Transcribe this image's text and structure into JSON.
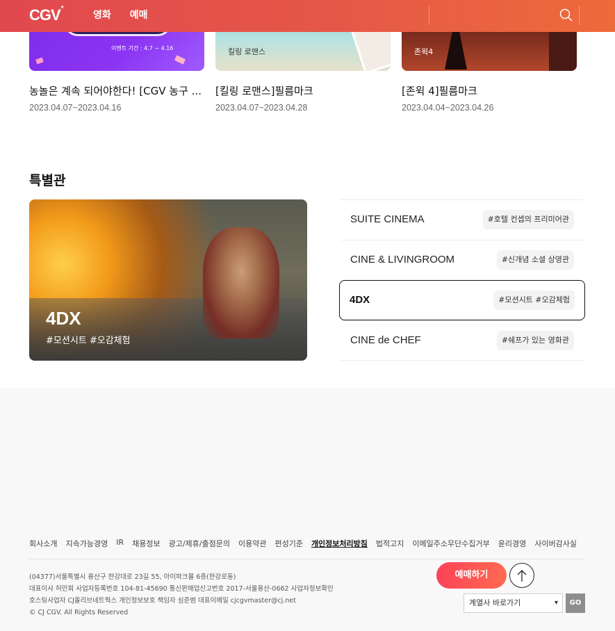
{
  "header": {
    "logo": "CGV",
    "logo_mark": "*",
    "nav": [
      "영화",
      "예매"
    ],
    "search_icon": "search-icon"
  },
  "events": [
    {
      "title": "농놀은 계속 되어야한다! [CGV 농구 ...",
      "date": "2023.04.07~2023.04.16",
      "thumb_text": "이벤트 기간 : 4.7 ~ 4.16"
    },
    {
      "title": "[킬링 로맨스]필름마크",
      "date": "2023.04.07~2023.04.28",
      "thumb_text": "킬링 로맨스"
    },
    {
      "title": "[존윅 4]필름마크",
      "date": "2023.04.04~2023.04.26",
      "thumb_text": "존윅4"
    }
  ],
  "special": {
    "title": "특별관",
    "visual": {
      "name": "4DX",
      "tags": "#모션시트 #오감체험"
    },
    "items": [
      {
        "name": "SUITE CINEMA",
        "tag": "#호텔 컨셉의 프리미어관"
      },
      {
        "name": "CINE & LIVINGROOM",
        "tag": "#신개념 소셜 상영관"
      },
      {
        "name": "4DX",
        "tag": "#모션시트 #오감체험"
      },
      {
        "name": "CINE de CHEF",
        "tag": "#쉐프가 있는 영화관"
      }
    ]
  },
  "footer": {
    "links": [
      "회사소개",
      "지속가능경영",
      "IR",
      "채용정보",
      "광고/제휴/출점문의",
      "이용약관",
      "편성기준",
      "개인정보처리방침",
      "법적고지",
      "이메일주소무단수집거부",
      "윤리경영",
      "사이버감사실"
    ],
    "info": [
      "(04377)서울특별시 용산구 한강대로 23길 55, 아이파크몰 6층(한강로동)",
      "대표이사 허민회 사업자등록번호 104-81-45690 통신판매업신고번호 2017-서울용산-0662 사업자정보확인",
      "호스팅사업자 CJ올리브네트웍스 개인정보보호 책임자 심준범 대표이메일 cjcgvmaster@cj.net",
      "© CJ CGV. All Rights Reserved"
    ],
    "reserve_label": "예매하기",
    "affiliate_select": "계열사 바로가기",
    "go_label": "GO"
  },
  "colors": {
    "brand": "#e1484f",
    "brand_end": "#ee6b3a",
    "reserve": "#fb4357"
  }
}
